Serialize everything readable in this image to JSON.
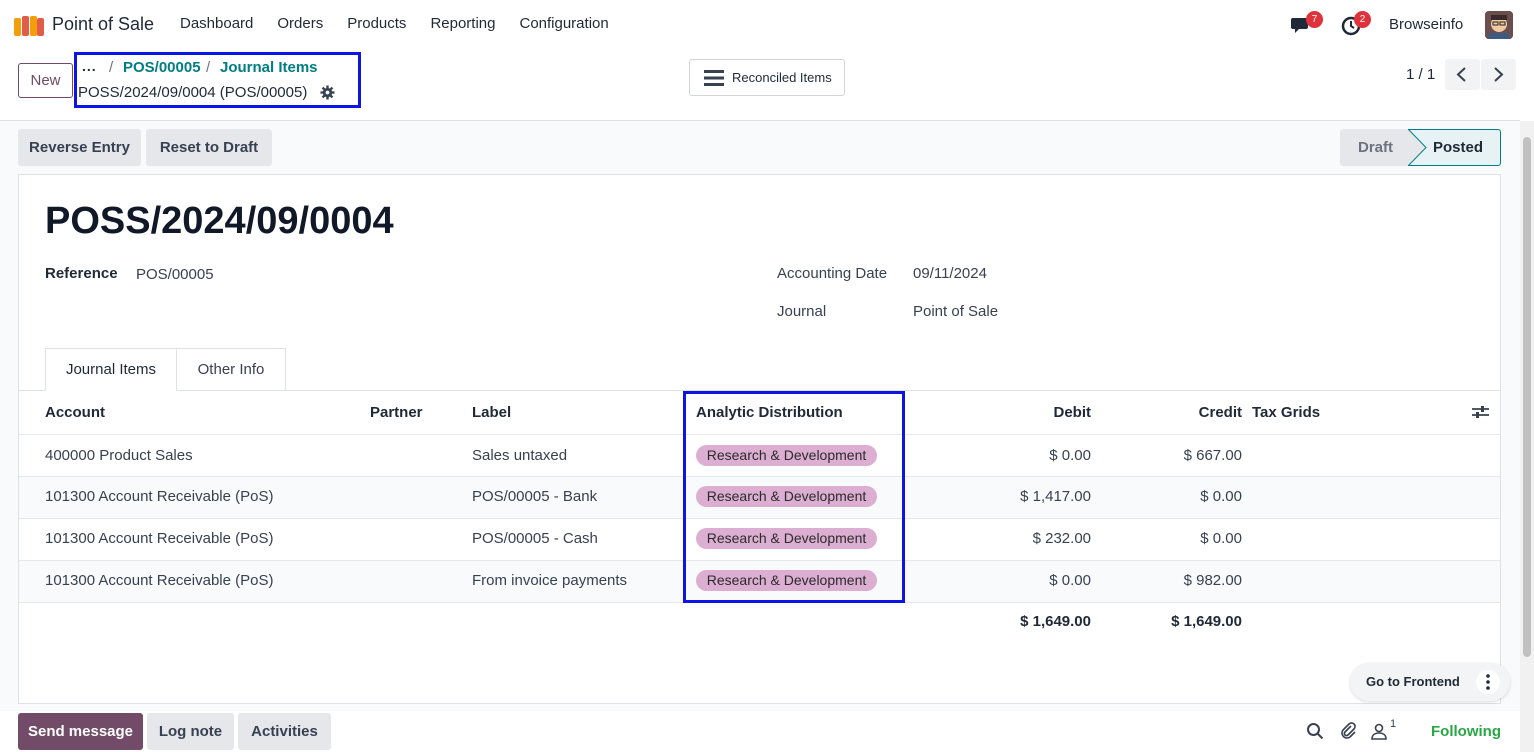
{
  "navbar": {
    "app_name": "Point of Sale",
    "menu": [
      "Dashboard",
      "Orders",
      "Products",
      "Reporting",
      "Configuration"
    ],
    "messages_count": "7",
    "activities_count": "2",
    "user_name": "Browseinfo"
  },
  "control": {
    "new_label": "New",
    "breadcrumb_dots": "...",
    "breadcrumb": [
      "POS/00005",
      "Journal Items"
    ],
    "current_record": "POSS/2024/09/0004 (POS/00005)",
    "reconciled_label": "Reconciled Items",
    "pager": "1 / 1"
  },
  "actions": {
    "reverse_entry": "Reverse Entry",
    "reset_to_draft": "Reset to Draft"
  },
  "status": {
    "draft": "Draft",
    "posted": "Posted"
  },
  "form": {
    "title": "POSS/2024/09/0004",
    "reference_label": "Reference",
    "reference_value": "POS/00005",
    "date_label": "Accounting Date",
    "date_value": "09/11/2024",
    "journal_label": "Journal",
    "journal_value": "Point of Sale"
  },
  "tabs": [
    "Journal Items",
    "Other Info"
  ],
  "table": {
    "headers": {
      "account": "Account",
      "partner": "Partner",
      "label": "Label",
      "analytic": "Analytic Distribution",
      "debit": "Debit",
      "credit": "Credit",
      "tax_grids": "Tax Grids"
    },
    "rows": [
      {
        "account": "400000 Product Sales",
        "partner": "",
        "label": "Sales untaxed",
        "analytic": "Research & Development",
        "debit": "$ 0.00",
        "credit": "$ 667.00"
      },
      {
        "account": "101300 Account Receivable (PoS)",
        "partner": "",
        "label": "POS/00005 - Bank",
        "analytic": "Research & Development",
        "debit": "$ 1,417.00",
        "credit": "$ 0.00"
      },
      {
        "account": "101300 Account Receivable (PoS)",
        "partner": "",
        "label": "POS/00005 - Cash",
        "analytic": "Research & Development",
        "debit": "$ 232.00",
        "credit": "$ 0.00"
      },
      {
        "account": "101300 Account Receivable (PoS)",
        "partner": "",
        "label": "From invoice payments",
        "analytic": "Research & Development",
        "debit": "$ 0.00",
        "credit": "$ 982.00"
      }
    ],
    "total_debit": "$ 1,649.00",
    "total_credit": "$ 1,649.00"
  },
  "goto_frontend": "Go to Frontend",
  "chatter": {
    "send_message": "Send message",
    "log_note": "Log note",
    "activities": "Activities",
    "followers_count": "1",
    "following": "Following"
  },
  "colors": {
    "brand": "#714b67",
    "link": "#017e84",
    "tag": "#dcaed2",
    "highlight": "#0d14e3",
    "following": "#28a745"
  }
}
